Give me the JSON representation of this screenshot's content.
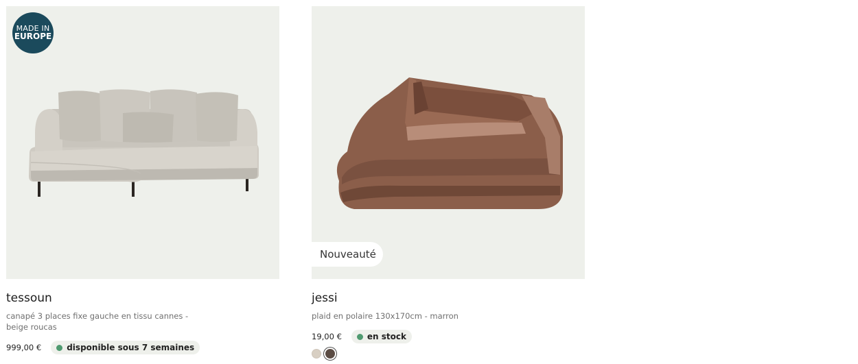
{
  "products": [
    {
      "badge_top": "MADE IN",
      "badge_bottom": "EUROPE",
      "name": "tessoun",
      "description": "canapé 3 places fixe gauche en tissu cannes - beige roucas",
      "price": "999,00 €",
      "availability": "disponible sous 7 semaines",
      "availability_color": "#4f9a70",
      "image": "beige-sofa"
    },
    {
      "tag": "Nouveauté",
      "name": "jessi",
      "description": "plaid en polaire 130x170cm - marron",
      "price": "19,00 €",
      "availability": "en stock",
      "availability_color": "#4f9a70",
      "image": "brown-folded-blanket",
      "color_options": [
        "#d8cfc3",
        "#5b4c44"
      ]
    }
  ]
}
